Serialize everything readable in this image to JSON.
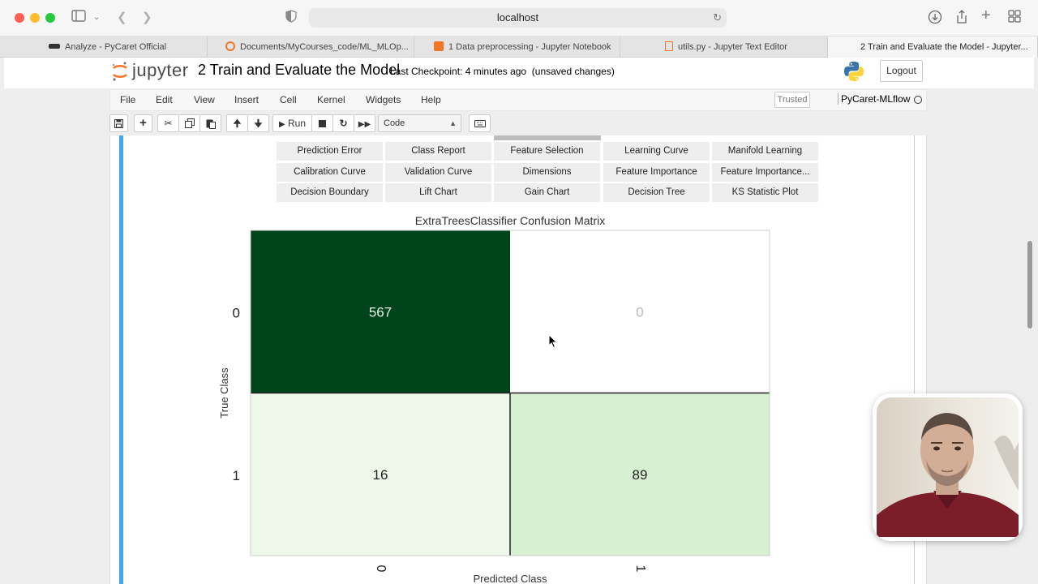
{
  "browser": {
    "url": "localhost",
    "tabs": [
      {
        "label": "Analyze - PyCaret Official",
        "icon": "pycaret-favicon",
        "active": false
      },
      {
        "label": "Documents/MyCourses_code/ML_MLOp...",
        "icon": "jupyter-favicon",
        "active": false
      },
      {
        "label": "1 Data preprocessing - Jupyter Notebook",
        "icon": "notebook-favicon",
        "active": false
      },
      {
        "label": "utils.py - Jupyter Text Editor",
        "icon": "file-favicon",
        "active": false
      },
      {
        "label": "2 Train and Evaluate the Model - Jupyter...",
        "icon": "",
        "active": true
      }
    ]
  },
  "jupyter": {
    "logo_text": "jupyter",
    "notebook_title": "2 Train and Evaluate the Model",
    "checkpoint": "Last Checkpoint: 4 minutes ago",
    "unsaved": "(unsaved changes)",
    "logout_label": "Logout",
    "menu": [
      "File",
      "Edit",
      "View",
      "Insert",
      "Cell",
      "Kernel",
      "Widgets",
      "Help"
    ],
    "trusted_label": "Trusted",
    "kernel_name": "PyCaret-MLflow",
    "toolbar": {
      "run_label": "Run",
      "cell_type": "Code"
    }
  },
  "plot_buttons": [
    [
      "Prediction Error",
      "Class Report",
      "Feature Selection",
      "Learning Curve",
      "Manifold Learning"
    ],
    [
      "Calibration Curve",
      "Validation Curve",
      "Dimensions",
      "Feature Importance",
      "Feature Importance..."
    ],
    [
      "Decision Boundary",
      "Lift Chart",
      "Gain Chart",
      "Decision Tree",
      "KS Statistic Plot"
    ]
  ],
  "chart_data": {
    "type": "heatmap",
    "title": "ExtraTreesClassifier Confusion Matrix",
    "xlabel": "Predicted Class",
    "ylabel": "True Class",
    "x_categories": [
      "0",
      "1"
    ],
    "y_categories": [
      "0",
      "1"
    ],
    "values": [
      [
        567,
        0
      ],
      [
        16,
        89
      ]
    ],
    "colormap": "Greens"
  }
}
